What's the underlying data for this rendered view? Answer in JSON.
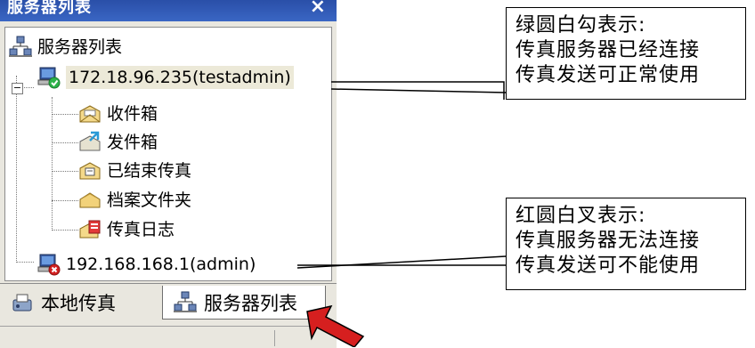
{
  "window": {
    "title": "服务器列表",
    "close_glyph": "×"
  },
  "tree": {
    "root_label": "服务器列表",
    "servers": [
      {
        "label": "172.18.96.235(testadmin)",
        "status": "connected",
        "status_color": "#2db34a",
        "folders": [
          {
            "label": "收件箱",
            "icon": "inbox-icon"
          },
          {
            "label": "发件箱",
            "icon": "outbox-icon"
          },
          {
            "label": "已结束传真",
            "icon": "finished-fax-icon"
          },
          {
            "label": "档案文件夹",
            "icon": "archive-folder-icon"
          },
          {
            "label": "传真日志",
            "icon": "fax-log-icon"
          }
        ]
      },
      {
        "label": "192.168.168.1(admin)",
        "status": "disconnected",
        "status_color": "#d32222"
      }
    ]
  },
  "tabs": [
    {
      "label": "本地传真",
      "icon": "local-fax-icon",
      "active": false
    },
    {
      "label": "服务器列表",
      "icon": "server-list-icon",
      "active": true
    }
  ],
  "callouts": [
    {
      "lines": [
        "绿圆白勾表示:",
        "传真服务器已经连接",
        "传真发送可正常使用"
      ]
    },
    {
      "lines": [
        "红圆白叉表示:",
        "传真服务器无法连接",
        "传真发送可不能使用"
      ]
    }
  ],
  "colors": {
    "title_bar": "#2a4fa8",
    "arrow": "#d61f1f"
  }
}
